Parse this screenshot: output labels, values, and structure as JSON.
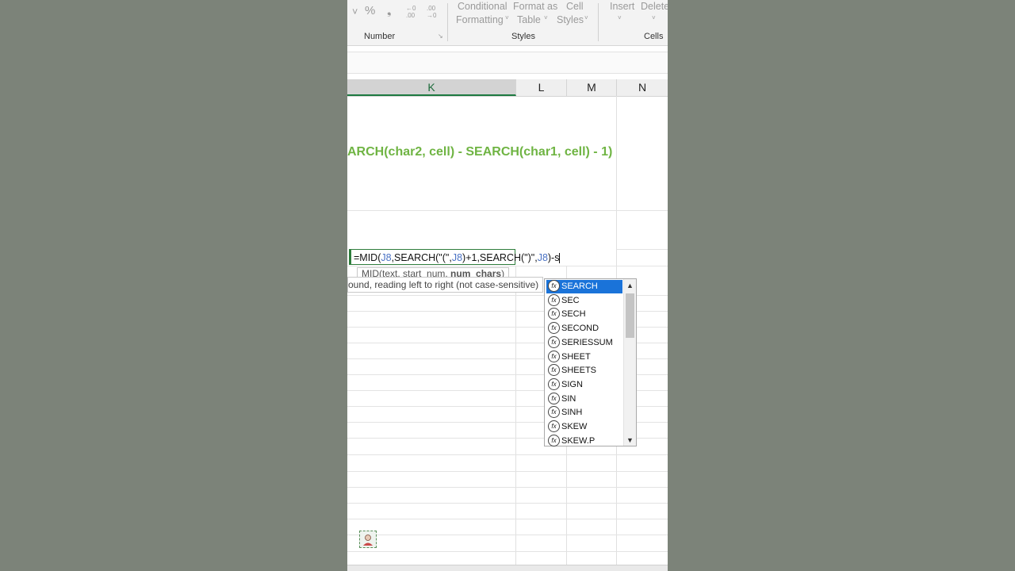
{
  "ribbon": {
    "number_glyphs": [
      "˅",
      "%",
      "❟",
      "←0 .00",
      ".00 →0"
    ],
    "conditional_formatting": [
      "Conditional",
      "Formatting"
    ],
    "format_as_table": [
      "Format as",
      "Table"
    ],
    "cell_styles": [
      "Cell",
      "Styles"
    ],
    "insert": "Insert",
    "delete": "Delete",
    "groups": {
      "number": "Number",
      "styles": "Styles",
      "cells": "Cells"
    }
  },
  "columns": [
    "K",
    "L",
    "M",
    "N"
  ],
  "sheet": {
    "heading_formula": "ARCH(char2, cell) - SEARCH(char1, cell) - 1)"
  },
  "edit": {
    "formula_parts": [
      {
        "text": "=MID(",
        "ref": false
      },
      {
        "text": "J8",
        "ref": true
      },
      {
        "text": ",SEARCH(\"(\",",
        "ref": false
      },
      {
        "text": "J8",
        "ref": true
      },
      {
        "text": ")+1,SEARCH(\")\",",
        "ref": false
      },
      {
        "text": "J8",
        "ref": true
      },
      {
        "text": ")-s",
        "ref": false
      }
    ],
    "tooltip_syntax_prefix": "MID(text, start_num, ",
    "tooltip_syntax_bold": "num_chars",
    "tooltip_syntax_suffix": ")",
    "tooltip_desc": "ound, reading left to right (not case-sensitive)"
  },
  "autocomplete": {
    "selected_index": 0,
    "items": [
      "SEARCH",
      "SEC",
      "SECH",
      "SECOND",
      "SERIESSUM",
      "SHEET",
      "SHEETS",
      "SIGN",
      "SIN",
      "SINH",
      "SKEW",
      "SKEW.P"
    ]
  },
  "colors": {
    "accent": "#1a73d9",
    "heading": "#6fb443",
    "cell_border": "#2e7d3c",
    "ref": "#4a72c4"
  }
}
